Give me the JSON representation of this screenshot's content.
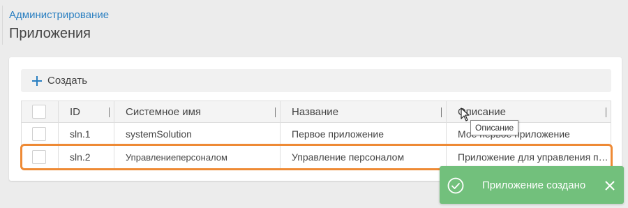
{
  "header": {
    "breadcrumb": "Администрирование",
    "title": "Приложения"
  },
  "toolbar": {
    "create_label": "Создать"
  },
  "table": {
    "columns": [
      "ID",
      "Системное имя",
      "Название",
      "Описание"
    ],
    "rows": [
      {
        "id": "sln.1",
        "system_name": "systemSolution",
        "name": "Первое приложение",
        "description": "Мое первое приложение"
      },
      {
        "id": "sln.2",
        "system_name": "Управлениеперсоналом",
        "name": "Управление персоналом",
        "description": "Приложение для управления персоналом"
      }
    ]
  },
  "tooltip": {
    "text": "Описание"
  },
  "toast": {
    "message": "Приложение создано",
    "color": "#72c07c"
  },
  "accent": {
    "link": "#2a7fc1",
    "highlight": "#ee8a35"
  }
}
